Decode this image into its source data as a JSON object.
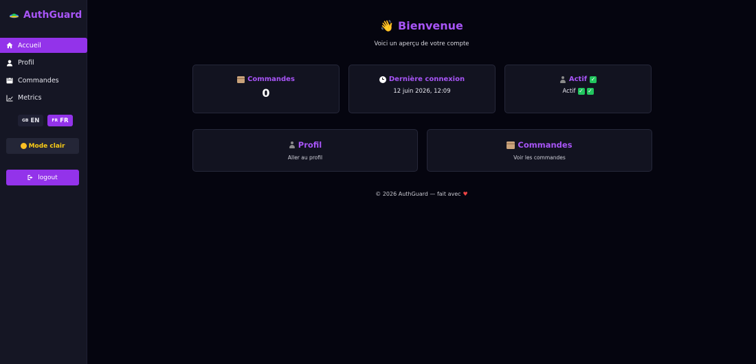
{
  "brand": {
    "name": "AuthGuard",
    "logo_icon": "ufo-icon"
  },
  "sidebar": {
    "items": [
      {
        "label": "Accueil",
        "icon": "home-icon",
        "active": true
      },
      {
        "label": "Profil",
        "icon": "user-icon",
        "active": false
      },
      {
        "label": "Commandes",
        "icon": "calendar-icon",
        "active": false
      },
      {
        "label": "Metrics",
        "icon": "chart-line-icon",
        "active": false
      }
    ],
    "languages": [
      {
        "flag": "GB",
        "code": "EN",
        "active": false
      },
      {
        "flag": "FR",
        "code": "FR",
        "active": true
      }
    ],
    "theme_button": "Mode clair",
    "logout_button": "logout"
  },
  "main": {
    "welcome_title": "Bienvenue",
    "subtitle": "Voici un aperçu de votre compte",
    "stats": {
      "orders": {
        "title": "Commandes",
        "value": "0"
      },
      "last_login": {
        "title": "Dernière connexion",
        "value": "12 juin 2026, 12:09"
      },
      "status": {
        "title": "Actif",
        "value": "Actif"
      }
    },
    "shortcuts": {
      "profile": {
        "title": "Profil",
        "subtitle": "Aller au profil"
      },
      "orders": {
        "title": "Commandes",
        "subtitle": "Voir les commandes"
      }
    },
    "footer": {
      "text": "© 2026 AuthGuard — fait avec"
    }
  },
  "colors": {
    "accent": "#9333ea",
    "accent_text": "#a855f7",
    "background": "#05050f",
    "sidebar": "#151624",
    "card": "#121320",
    "success": "#22c55e",
    "heart": "#ef4444"
  }
}
